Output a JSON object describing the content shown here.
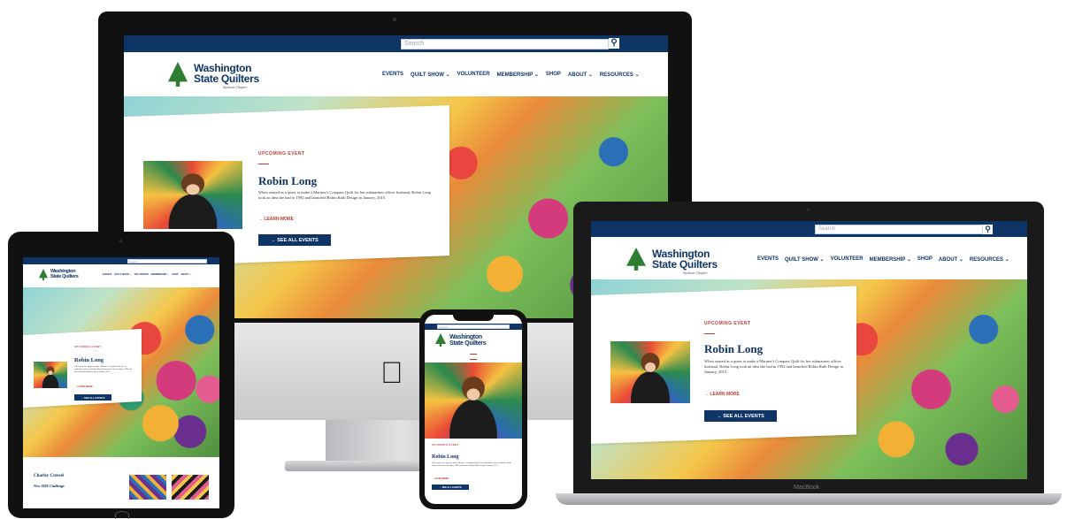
{
  "site": {
    "search_placeholder": "Search",
    "logo_title_line1": "Washington",
    "logo_title_line2": "State Quilters",
    "logo_subtitle": "Spokane Chapter",
    "nav": [
      "EVENTS",
      "QUILT SHOW ⌄",
      "VOLUNTEER",
      "MEMBERSHIP ⌄",
      "SHOP",
      "ABOUT ⌄",
      "RESOURCES ⌄"
    ],
    "eyebrow": "UPCOMING EVENT",
    "speaker_name": "Robin Long",
    "bio": "When started as a quest to make a Mariner's Compass Quilt for her submariner officer husband, Robin Long took an idea she had in 1992 and launched Robin Ruth Design in January, 2015.",
    "learn_more": "→ LEARN MORE",
    "see_all": "→ SEE ALL EVENTS"
  },
  "tablet_extra": {
    "heading": "Charley Cressel",
    "subheading": "New 2020 Challenge"
  },
  "laptop": {
    "brand_label": "MacBook"
  },
  "colors": {
    "brand_navy": "#0f3566",
    "accent_red": "#c0392b",
    "logo_green": "#2e7d32"
  }
}
